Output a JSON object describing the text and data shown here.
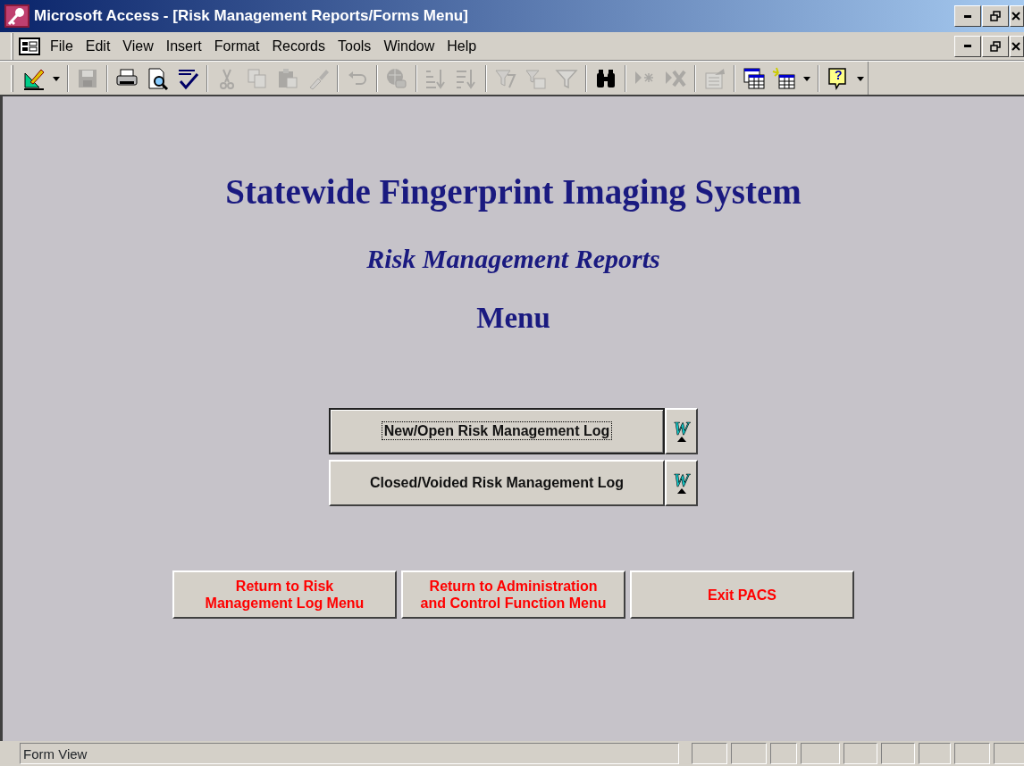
{
  "window": {
    "title": "Microsoft Access - [Risk Management Reports/Forms Menu]"
  },
  "menu_bar": {
    "items": [
      {
        "label": "File"
      },
      {
        "label": "Edit"
      },
      {
        "label": "View"
      },
      {
        "label": "Insert"
      },
      {
        "label": "Format"
      },
      {
        "label": "Records"
      },
      {
        "label": "Tools"
      },
      {
        "label": "Window"
      },
      {
        "label": "Help"
      }
    ]
  },
  "toolbar": [
    {
      "kind": "design",
      "disabled": false
    },
    {
      "kind": "dropdown",
      "disabled": false
    },
    {
      "kind": "separator"
    },
    {
      "kind": "save",
      "disabled": true
    },
    {
      "kind": "separator"
    },
    {
      "kind": "print",
      "disabled": false
    },
    {
      "kind": "preview",
      "disabled": false
    },
    {
      "kind": "spelling",
      "disabled": false
    },
    {
      "kind": "separator"
    },
    {
      "kind": "cut",
      "disabled": true
    },
    {
      "kind": "copy",
      "disabled": true
    },
    {
      "kind": "paste",
      "disabled": true
    },
    {
      "kind": "brush",
      "disabled": true
    },
    {
      "kind": "separator"
    },
    {
      "kind": "undo",
      "disabled": true
    },
    {
      "kind": "separator"
    },
    {
      "kind": "globe",
      "disabled": true
    },
    {
      "kind": "separator"
    },
    {
      "kind": "sort_asc",
      "disabled": true
    },
    {
      "kind": "sort_desc",
      "disabled": true
    },
    {
      "kind": "separator"
    },
    {
      "kind": "filter_sel",
      "disabled": true
    },
    {
      "kind": "filter_form",
      "disabled": true
    },
    {
      "kind": "filter",
      "disabled": true
    },
    {
      "kind": "separator"
    },
    {
      "kind": "find",
      "disabled": false
    },
    {
      "kind": "separator"
    },
    {
      "kind": "new_record",
      "disabled": true
    },
    {
      "kind": "delete_record",
      "disabled": true
    },
    {
      "kind": "separator"
    },
    {
      "kind": "properties",
      "disabled": true
    },
    {
      "kind": "separator"
    },
    {
      "kind": "database",
      "disabled": false
    },
    {
      "kind": "new_object",
      "disabled": false
    },
    {
      "kind": "dropdown",
      "disabled": false
    },
    {
      "kind": "separator"
    },
    {
      "kind": "help",
      "disabled": false,
      "glyph": "?"
    },
    {
      "kind": "dropdown",
      "disabled": false
    }
  ],
  "form": {
    "title": "Statewide Fingerprint Imaging System",
    "subtitle": "Risk Management Reports",
    "heading": "Menu",
    "report_buttons": [
      {
        "label": "New/Open Risk Management Log",
        "focused": true,
        "word_glyph": "W"
      },
      {
        "label": "Closed/Voided Risk Management Log",
        "focused": false,
        "word_glyph": "W"
      }
    ],
    "nav_buttons": [
      {
        "label": "Return to Risk\nManagement Log Menu"
      },
      {
        "label": "Return to Administration\nand Control Function Menu"
      },
      {
        "label": "Exit PACS"
      }
    ]
  },
  "status_bar": {
    "text": "Form View"
  }
}
